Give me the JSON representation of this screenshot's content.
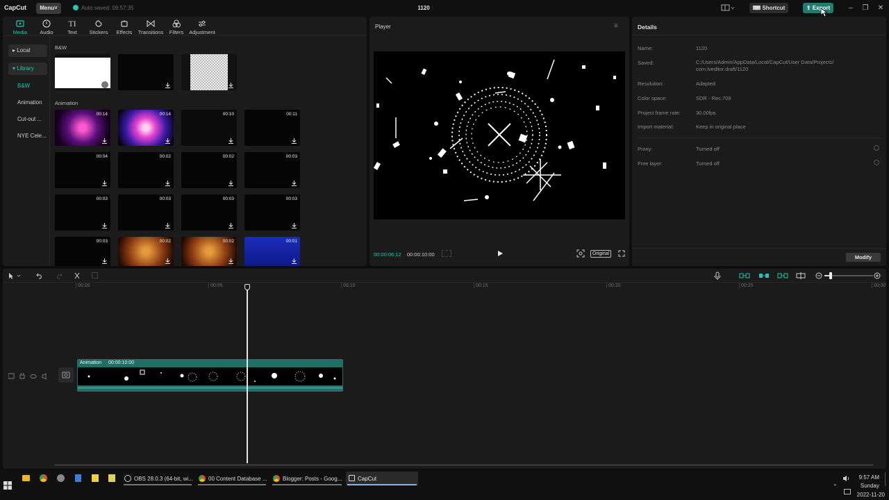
{
  "app": {
    "logo": "CapCut",
    "menu_label": "Menu",
    "autosave": "Auto saved: 09:57:35",
    "window_title": "1120",
    "shortcut_label": "Shortcut",
    "export_label": "Export"
  },
  "toolbar": [
    {
      "label": "Media",
      "icon": "media-icon"
    },
    {
      "label": "Audio",
      "icon": "audio-icon"
    },
    {
      "label": "Text",
      "icon": "text-icon"
    },
    {
      "label": "Stickers",
      "icon": "stickers-icon"
    },
    {
      "label": "Effects",
      "icon": "effects-icon"
    },
    {
      "label": "Transitions",
      "icon": "transitions-icon"
    },
    {
      "label": "Filters",
      "icon": "filters-icon"
    },
    {
      "label": "Adjustment",
      "icon": "adjustment-icon"
    }
  ],
  "sidebar": [
    {
      "label": "▸ Local"
    },
    {
      "label": "▾ Library"
    },
    {
      "label": "B&W"
    },
    {
      "label": "Animation"
    },
    {
      "label": "Cut-out ..."
    },
    {
      "label": "NYE Cele..."
    }
  ],
  "media": {
    "section_bw": "B&W",
    "section_anim": "Animation",
    "durations": [
      "00:14",
      "00:14",
      "00:10",
      "00:11",
      "00:04",
      "00:02",
      "00:02",
      "00:03",
      "00:03",
      "00:03",
      "00:03",
      "00:03",
      "00:03",
      "00:02",
      "00:02",
      "00:01"
    ]
  },
  "player": {
    "title": "Player",
    "current_time": "00:00:06:12",
    "total_time": "00:00:10:00",
    "ratio_label": "Original"
  },
  "details": {
    "title": "Details",
    "rows": [
      {
        "k": "Name:",
        "v": "1120"
      },
      {
        "k": "Saved:",
        "v": "C:/Users/Admin/AppData/Local/CapCut/User Data/Projects/ com.lveditor.draft/1120"
      },
      {
        "k": "Resolution:",
        "v": "Adapted"
      },
      {
        "k": "Color space:",
        "v": "SDR - Rec.709"
      },
      {
        "k": "Project frame rate:",
        "v": "30.00fps"
      },
      {
        "k": "Import material:",
        "v": "Keep in original place"
      },
      {
        "k": "Proxy:",
        "v": "Turned off"
      },
      {
        "k": "Free layer:",
        "v": "Turned off"
      }
    ],
    "modify_label": "Modify"
  },
  "timeline": {
    "ruler": [
      "00:00",
      "00:05",
      "00:10",
      "00:15",
      "00:20",
      "00:25",
      "00:30"
    ],
    "clip_name": "Animation",
    "clip_duration": "00:00:10:00",
    "playhead_fraction": 0.64
  },
  "taskbar": {
    "apps": [
      "OBS 28.0.3 (64-bit, wi...",
      "00 Content Database ...",
      "Blogger: Posts - Goog...",
      "CapCut"
    ],
    "time": "9:57 AM",
    "day": "Sunday",
    "date": "2022-11-20"
  },
  "colors": {
    "accent": "#20c6b3",
    "clip": "#1f6f66",
    "export": "#1f7c6e"
  }
}
